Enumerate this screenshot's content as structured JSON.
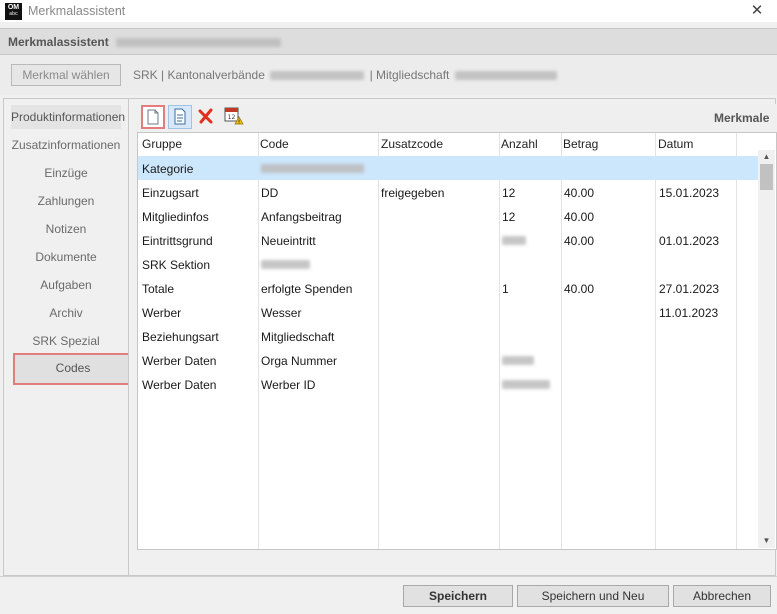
{
  "window": {
    "title": "Merkmalassistent",
    "logo_text": "OM",
    "logo_sub": "abc",
    "close_glyph": "✕"
  },
  "header": {
    "title": "Merkmalassistent"
  },
  "subheader": {
    "button_label": "Merkmal wählen",
    "context_part1": "SRK | Kantonalverbände",
    "context_part2": "| Mitgliedschaft"
  },
  "sidebar": {
    "items": [
      {
        "label": "Produktinformationen"
      },
      {
        "label": "Zusatzinformationen"
      },
      {
        "label": "Einzüge"
      },
      {
        "label": "Zahlungen"
      },
      {
        "label": "Notizen"
      },
      {
        "label": "Dokumente"
      },
      {
        "label": "Aufgaben"
      },
      {
        "label": "Archiv"
      },
      {
        "label": "SRK Spezial"
      },
      {
        "label": "Codes"
      }
    ],
    "active": "Codes"
  },
  "toolbar": {
    "section_label": "Merkmale",
    "icons": [
      "new-document-icon",
      "copy-document-icon",
      "delete-icon",
      "calendar-warning-icon"
    ]
  },
  "grid": {
    "columns": [
      "Gruppe",
      "Code",
      "Zusatzcode",
      "Anzahl",
      "Betrag",
      "Datum"
    ],
    "rows": [
      {
        "gruppe": "Kategorie",
        "code": "",
        "zusatzcode": "",
        "anzahl": "",
        "betrag": "",
        "datum": ""
      },
      {
        "gruppe": "Einzugsart",
        "code": "DD",
        "zusatzcode": "freigegeben",
        "anzahl": "12",
        "betrag": "40.00",
        "datum": "15.01.2023"
      },
      {
        "gruppe": "Mitgliedinfos",
        "code": "Anfangsbeitrag",
        "zusatzcode": "",
        "anzahl": "12",
        "betrag": "40.00",
        "datum": ""
      },
      {
        "gruppe": "Eintrittsgrund",
        "code": "Neueintritt",
        "zusatzcode": "",
        "anzahl": "",
        "betrag": "40.00",
        "datum": "01.01.2023"
      },
      {
        "gruppe": "SRK Sektion",
        "code": "",
        "zusatzcode": "",
        "anzahl": "",
        "betrag": "",
        "datum": ""
      },
      {
        "gruppe": "Totale",
        "code": "erfolgte Spenden",
        "zusatzcode": "",
        "anzahl": "1",
        "betrag": "40.00",
        "datum": "27.01.2023"
      },
      {
        "gruppe": "Werber",
        "code": "Wesser",
        "zusatzcode": "",
        "anzahl": "",
        "betrag": "",
        "datum": "11.01.2023"
      },
      {
        "gruppe": "Beziehungsart",
        "code": "Mitgliedschaft",
        "zusatzcode": "",
        "anzahl": "",
        "betrag": "",
        "datum": ""
      },
      {
        "gruppe": "Werber Daten",
        "code": "Orga Nummer",
        "zusatzcode": "",
        "anzahl": "",
        "betrag": "",
        "datum": ""
      },
      {
        "gruppe": "Werber Daten",
        "code": "Werber ID",
        "zusatzcode": "",
        "anzahl": "",
        "betrag": "",
        "datum": ""
      }
    ]
  },
  "buttons": {
    "save": "Speichern",
    "save_new": "Speichern und Neu",
    "cancel": "Abbrechen"
  },
  "colors": {
    "selection": "#cce6fb",
    "highlight_border": "#e07e7e",
    "delete_red": "#e0301e"
  }
}
